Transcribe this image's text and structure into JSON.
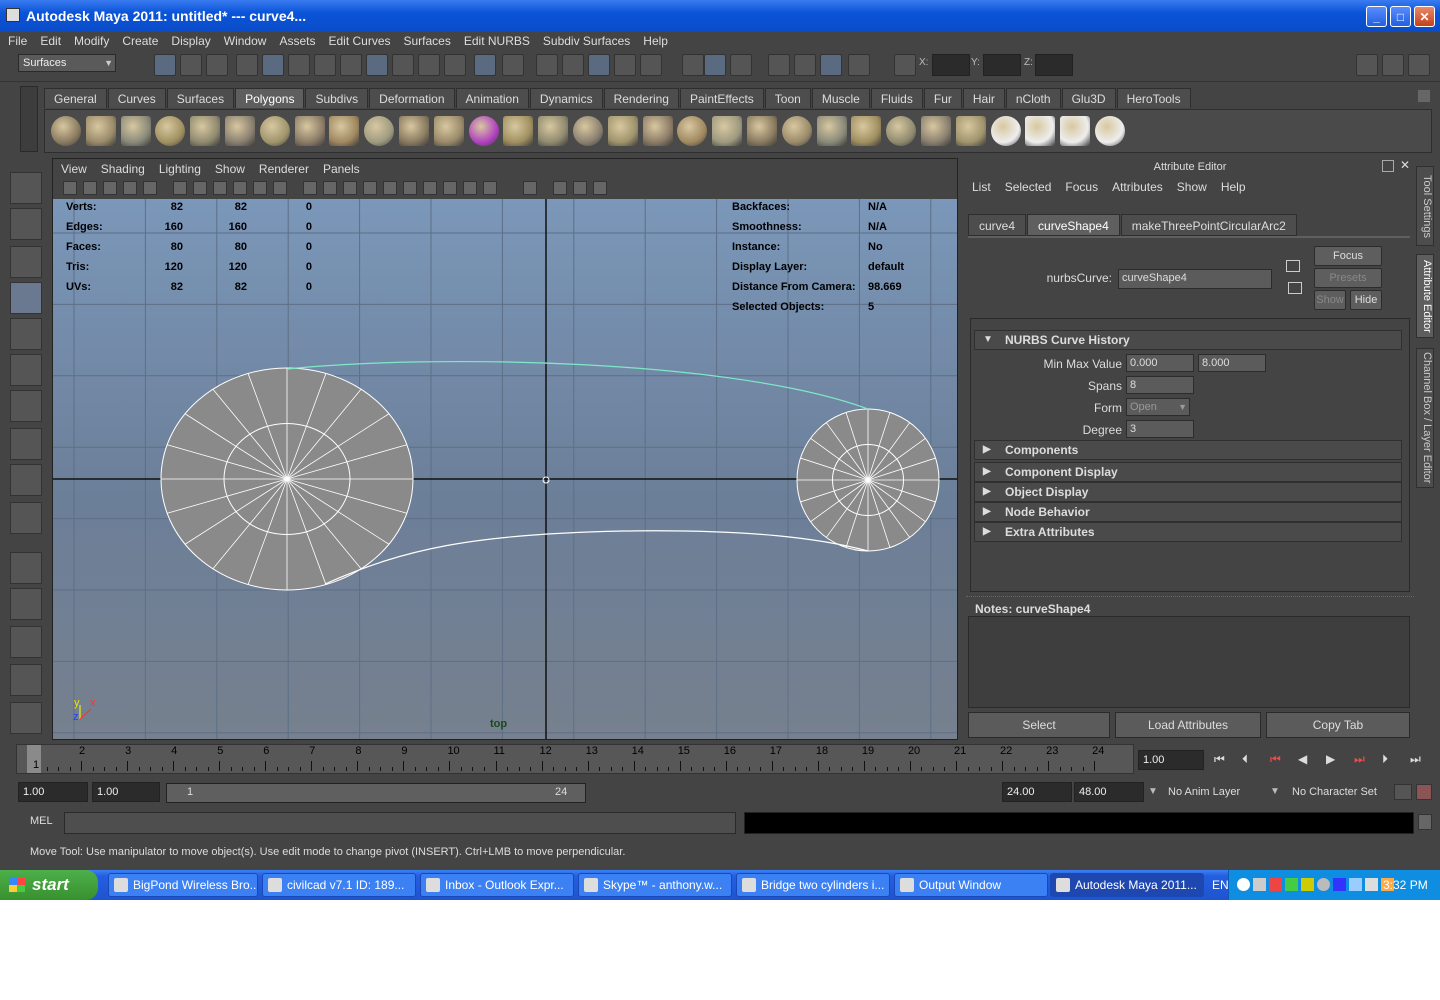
{
  "window": {
    "title": "Autodesk Maya 2011: untitled*   ---   curve4...",
    "minimize": "_",
    "maximize": "□",
    "close": "✕"
  },
  "menu": [
    "File",
    "Edit",
    "Modify",
    "Create",
    "Display",
    "Window",
    "Assets",
    "Edit Curves",
    "Surfaces",
    "Edit NURBS",
    "Subdiv Surfaces",
    "Help"
  ],
  "toolbar": {
    "menu_set": "Surfaces",
    "x_label": "X:",
    "y_label": "Y:",
    "z_label": "Z:"
  },
  "shelf": {
    "tabs": [
      "General",
      "Curves",
      "Surfaces",
      "Polygons",
      "Subdivs",
      "Deformation",
      "Animation",
      "Dynamics",
      "Rendering",
      "PaintEffects",
      "Toon",
      "Muscle",
      "Fluids",
      "Fur",
      "Hair",
      "nCloth",
      "Glu3D",
      "HeroTools"
    ],
    "active": "Polygons"
  },
  "viewport": {
    "menu": [
      "View",
      "Shading",
      "Lighting",
      "Show",
      "Renderer",
      "Panels"
    ],
    "camera": "top",
    "axis_y": "y",
    "axis_x": "x",
    "axis_z": "z",
    "hud_left": [
      {
        "label": "Verts:",
        "a": "82",
        "b": "82",
        "c": "0"
      },
      {
        "label": "Edges:",
        "a": "160",
        "b": "160",
        "c": "0"
      },
      {
        "label": "Faces:",
        "a": "80",
        "b": "80",
        "c": "0"
      },
      {
        "label": "Tris:",
        "a": "120",
        "b": "120",
        "c": "0"
      },
      {
        "label": "UVs:",
        "a": "82",
        "b": "82",
        "c": "0"
      }
    ],
    "hud_right": [
      {
        "label": "Backfaces:",
        "value": "N/A"
      },
      {
        "label": "Smoothness:",
        "value": "N/A"
      },
      {
        "label": "Instance:",
        "value": "No"
      },
      {
        "label": "Display Layer:",
        "value": "default"
      },
      {
        "label": "Distance From Camera:",
        "value": "98.669"
      },
      {
        "label": "Selected Objects:",
        "value": "5"
      }
    ]
  },
  "attribute_editor": {
    "title": "Attribute Editor",
    "menu": [
      "List",
      "Selected",
      "Focus",
      "Attributes",
      "Show",
      "Help"
    ],
    "tabs": [
      "curve4",
      "curveShape4",
      "makeThreePointCircularArc2"
    ],
    "active_tab": "curveShape4",
    "node_label": "nurbsCurve:",
    "node_value": "curveShape4",
    "focus_btn": "Focus",
    "presets_btn": "Presets",
    "show_btn": "Show",
    "hide_btn": "Hide",
    "history_title": "NURBS Curve History",
    "min_max_label": "Min Max Value",
    "min_value": "0.000",
    "max_value": "8.000",
    "spans_label": "Spans",
    "spans_value": "8",
    "form_label": "Form",
    "form_value": "Open",
    "degree_label": "Degree",
    "degree_value": "3",
    "sections": [
      "Components",
      "Component Display",
      "Object Display",
      "Node Behavior",
      "Extra Attributes"
    ],
    "notes_label": "Notes:  curveShape4",
    "select_btn": "Select",
    "load_btn": "Load Attributes",
    "copy_btn": "Copy Tab"
  },
  "side_tabs": [
    "Tool Settings",
    "Attribute Editor",
    "Channel Box / Layer Editor"
  ],
  "timeline": {
    "ticks": [
      "1",
      "2",
      "3",
      "4",
      "5",
      "6",
      "7",
      "8",
      "9",
      "10",
      "11",
      "12",
      "13",
      "14",
      "15",
      "16",
      "17",
      "18",
      "19",
      "20",
      "21",
      "22",
      "23",
      "24"
    ],
    "current_marker": "1",
    "current_time": "1.00"
  },
  "range": {
    "start": "1.00",
    "start2": "1.00",
    "range_start": "1",
    "range_end": "24",
    "end": "24.00",
    "end2": "48.00",
    "anim_layer": "No Anim Layer",
    "char_set": "No Character Set"
  },
  "command": {
    "label": "MEL"
  },
  "help_line": "Move Tool: Use manipulator to move object(s). Use edit mode to change pivot (INSERT).  Ctrl+LMB to move perpendicular.",
  "taskbar": {
    "start": "start",
    "items": [
      {
        "label": "BigPond Wireless Bro...",
        "active": false
      },
      {
        "label": "civilcad v7.1  ID: 189...",
        "active": false
      },
      {
        "label": "Inbox - Outlook Expr...",
        "active": false
      },
      {
        "label": "Skype™ - anthony.w...",
        "active": false
      },
      {
        "label": "Bridge two cylinders i...",
        "active": false
      },
      {
        "label": "Output Window",
        "active": false
      },
      {
        "label": "Autodesk Maya 2011...",
        "active": true
      }
    ],
    "lang": "EN",
    "clock": "3:32 PM"
  },
  "colors": {
    "selected_curve": "#7fe8c8",
    "wire": "#ffffff",
    "poly_fill": "#8a8a8a"
  }
}
